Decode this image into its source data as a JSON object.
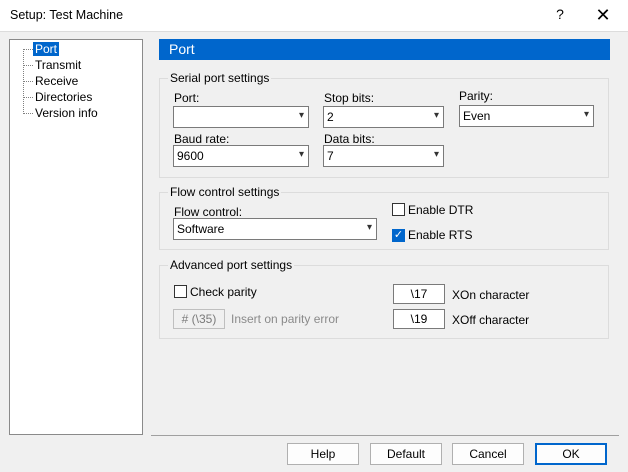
{
  "window": {
    "title": "Setup: Test Machine",
    "help_glyph": "?",
    "close_glyph": "✕"
  },
  "tree": {
    "items": [
      {
        "label": "Port",
        "selected": true
      },
      {
        "label": "Transmit"
      },
      {
        "label": "Receive"
      },
      {
        "label": "Directories"
      },
      {
        "label": "Version info"
      }
    ]
  },
  "page": {
    "header": "Port"
  },
  "serial": {
    "title": "Serial port settings",
    "port_label": "Port:",
    "port_value": "",
    "stop_bits_label": "Stop bits:",
    "stop_bits_value": "2",
    "parity_label": "Parity:",
    "parity_value": "Even",
    "baud_label": "Baud rate:",
    "baud_value": "9600",
    "data_bits_label": "Data bits:",
    "data_bits_value": "7"
  },
  "flow": {
    "title": "Flow control settings",
    "flow_label": "Flow control:",
    "flow_value": "Software",
    "dtr_label": "Enable DTR",
    "dtr_checked": false,
    "rts_label": "Enable RTS",
    "rts_checked": true
  },
  "advanced": {
    "title": "Advanced port settings",
    "check_parity_label": "Check parity",
    "check_parity_checked": false,
    "parity_error_value": "# (\\35)",
    "parity_error_label": "Insert on parity error",
    "xon_value": "\\17",
    "xon_label": "XOn character",
    "xoff_value": "\\19",
    "xoff_label": "XOff character"
  },
  "buttons": {
    "help": "Help",
    "default": "Default",
    "cancel": "Cancel",
    "ok": "OK"
  },
  "glyphs": {
    "arrow": "▾",
    "check": "✓"
  },
  "colors": {
    "accent": "#0066cc"
  }
}
